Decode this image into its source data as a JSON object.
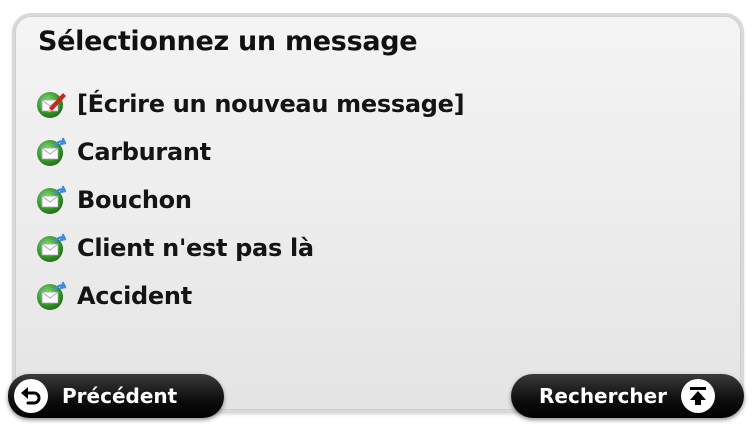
{
  "screen": {
    "title": "Sélectionnez un message"
  },
  "messages": [
    {
      "label": "[Écrire un nouveau message]",
      "icon": "compose-message-icon"
    },
    {
      "label": "Carburant",
      "icon": "message-envelope-icon"
    },
    {
      "label": "Bouchon",
      "icon": "message-envelope-icon"
    },
    {
      "label": "Client n'est pas là",
      "icon": "message-envelope-icon"
    },
    {
      "label": "Accident",
      "icon": "message-envelope-icon"
    }
  ],
  "buttons": {
    "back_label": "Précédent",
    "back_icon": "back-arrow-icon",
    "search_label": "Rechercher",
    "search_icon": "search-up-icon"
  },
  "colors": {
    "icon_green": "#3a9a2e",
    "envelope_blue": "#3f8fd6",
    "pencil_red": "#c8281e",
    "button_black": "#0d0d0d"
  }
}
